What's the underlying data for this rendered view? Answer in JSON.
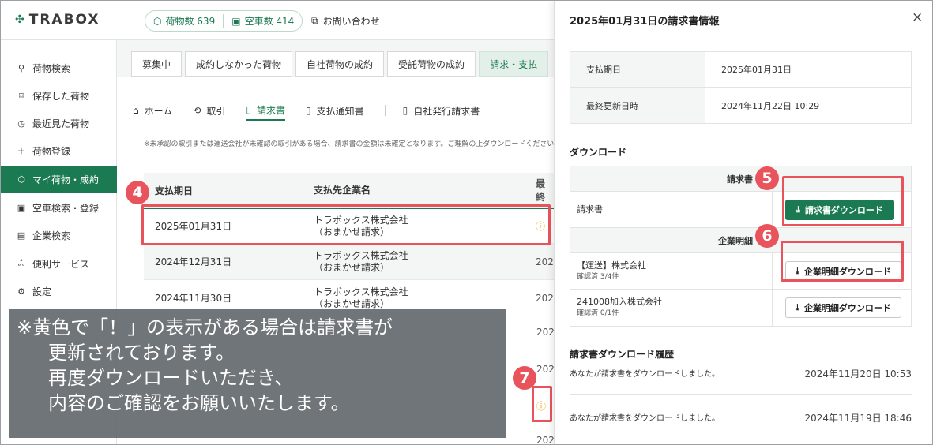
{
  "header": {
    "logo": "TRABOX",
    "cargo_count": "荷物数 639",
    "vehicle_count": "空車数 414",
    "contact": "お問い合わせ"
  },
  "sidebar": {
    "items": [
      {
        "label": "荷物検索",
        "icon": "search-icon"
      },
      {
        "label": "保存した荷物",
        "icon": "bookmark-icon"
      },
      {
        "label": "最近見た荷物",
        "icon": "clock-icon"
      },
      {
        "label": "荷物登録",
        "icon": "plus-icon"
      },
      {
        "label": "マイ荷物・成約",
        "icon": "box-icon"
      },
      {
        "label": "空車検索・登録",
        "icon": "truck-icon"
      },
      {
        "label": "企業検索",
        "icon": "building-icon"
      },
      {
        "label": "便利サービス",
        "icon": "people-icon"
      },
      {
        "label": "設定",
        "icon": "gear-icon"
      }
    ]
  },
  "tabs": [
    "募集中",
    "成約しなかった荷物",
    "自社荷物の成約",
    "受託荷物の成約",
    "請求・支払"
  ],
  "subnav": {
    "home": "ホーム",
    "deals": "取引",
    "invoices": "請求書",
    "payment_notices": "支払通知書",
    "self_invoices": "自社発行請求書"
  },
  "notice": "※未承認の取引または運送会社が未確認の取引がある場合、請求書の金額は未確定となります。ご理解の上ダウンロードください。",
  "table": {
    "headers": [
      "支払期日",
      "支払先企業名",
      "最終"
    ],
    "rows": [
      {
        "date": "2025年01月31日",
        "company": "トラボックス株式会社",
        "note": "（おまかせ請求）",
        "last": "!"
      },
      {
        "date": "2024年12月31日",
        "company": "トラボックス株式会社",
        "note": "（おまかせ請求）",
        "last": "202"
      },
      {
        "date": "2024年11月30日",
        "company": "トラボックス株式会社",
        "note": "（おまかせ請求）",
        "last": "202"
      }
    ],
    "extra_last": [
      "202",
      "202",
      "!",
      "202"
    ]
  },
  "badges": {
    "b4": "4",
    "b5": "5",
    "b6": "6",
    "b7": "7"
  },
  "overlay": {
    "line1": "※黄色で「！」の表示がある場合は請求書が",
    "line2": "更新されております。",
    "line3": "再度ダウンロードいただき、",
    "line4": "内容のご確認をお願いいたします。"
  },
  "drawer": {
    "title": "2025年01月31日の請求書情報",
    "close": "×",
    "info": [
      {
        "key": "支払期日",
        "value": "2025年01月31日"
      },
      {
        "key": "最終更新日時",
        "value": "2024年11月22日 10:29"
      }
    ],
    "download_heading": "ダウンロード",
    "invoice_section": "請求書",
    "invoice_label": "請求書",
    "invoice_button": "請求書ダウンロード",
    "company_section": "企業明細",
    "companies": [
      {
        "name": "【運送】株式会社",
        "status": "確認済 3/4件",
        "button": "企業明細ダウンロード"
      },
      {
        "name": "241008加入株式会社",
        "status": "確認済 0/1件",
        "button": "企業明細ダウンロード"
      }
    ],
    "history_heading": "請求書ダウンロード履歴",
    "history": [
      {
        "text": "あなたが請求書をダウンロードしました。",
        "time": "2024年11月20日 10:53"
      },
      {
        "text": "あなたが請求書をダウンロードしました。",
        "time": "2024年11月19日 18:46"
      }
    ]
  },
  "colors": {
    "brand": "#1b7a52",
    "highlight": "#e9535b",
    "warning": "#e5a400"
  }
}
